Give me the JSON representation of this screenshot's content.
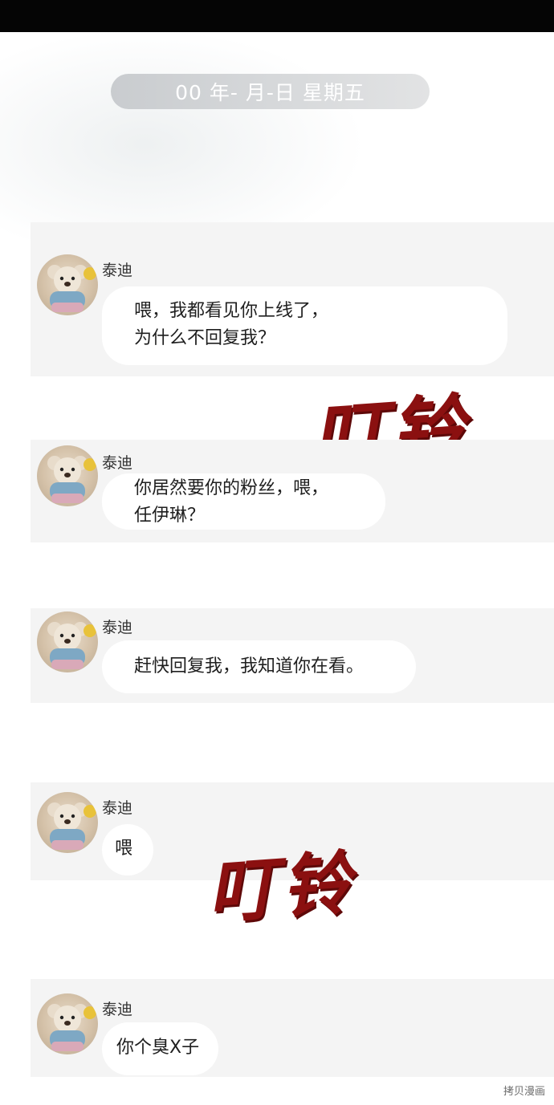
{
  "date_header": "00 年- 月-日 星期五",
  "sender_name": "泰迪",
  "messages": [
    {
      "sender": "泰迪",
      "text": "喂，我都看见你上线了，\n为什么不回复我？"
    },
    {
      "sender": "泰迪",
      "text": "你居然要你的粉丝，喂，\n任伊琳？"
    },
    {
      "sender": "泰迪",
      "text": "赶快回复我，我知道你在看。"
    },
    {
      "sender": "泰迪",
      "text": "喂"
    },
    {
      "sender": "泰迪",
      "text": "你个臭X子"
    }
  ],
  "sound_effects": [
    "叮铃",
    "叮铃"
  ],
  "watermark": "拷贝漫画",
  "colors": {
    "top_bar": "#050505",
    "date_pill": "#d3d5d7",
    "message_band": "#f4f4f4",
    "bubble": "#ffffff",
    "sound_effect": "#8b1010"
  },
  "icons": {
    "avatar": "teddy-bear-avatar"
  }
}
